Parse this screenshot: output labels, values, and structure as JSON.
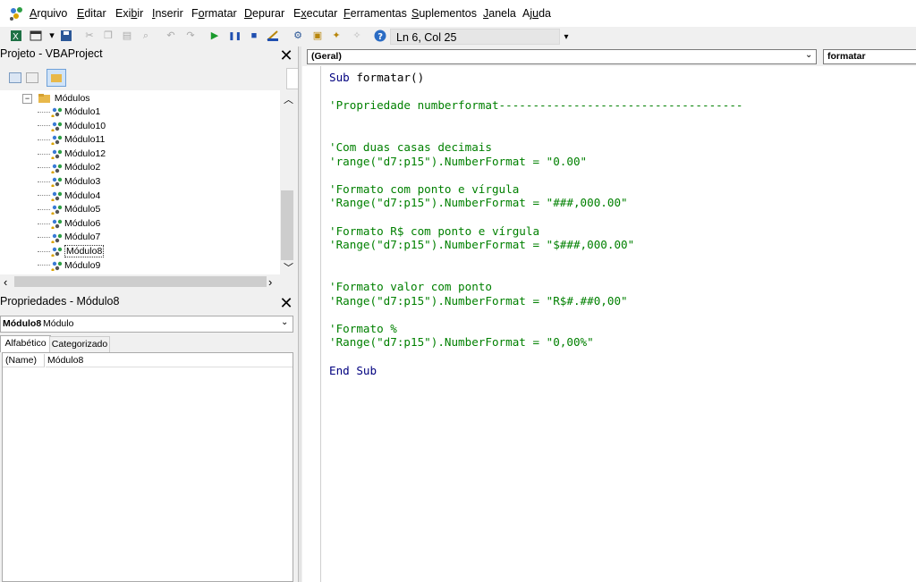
{
  "menu": [
    {
      "pre": "",
      "u": "A",
      "post": "rquivo"
    },
    {
      "pre": "",
      "u": "E",
      "post": "ditar"
    },
    {
      "pre": "Exi",
      "u": "b",
      "post": "ir"
    },
    {
      "pre": "",
      "u": "I",
      "post": "nserir"
    },
    {
      "pre": "F",
      "u": "o",
      "post": "rmatar"
    },
    {
      "pre": "",
      "u": "D",
      "post": "epurar"
    },
    {
      "pre": "E",
      "u": "x",
      "post": "ecutar"
    },
    {
      "pre": "",
      "u": "F",
      "post": "erramentas"
    },
    {
      "pre": "",
      "u": "S",
      "post": "uplementos"
    },
    {
      "pre": "",
      "u": "J",
      "post": "anela"
    },
    {
      "pre": "Aj",
      "u": "u",
      "post": "da"
    }
  ],
  "toolbar": {
    "cursor_position": "Ln 6, Col 25"
  },
  "project": {
    "title": "Projeto - VBAProject",
    "folder": "Módulos",
    "modules": [
      "Módulo1",
      "Módulo10",
      "Módulo11",
      "Módulo12",
      "Módulo2",
      "Módulo3",
      "Módulo4",
      "Módulo5",
      "Módulo6",
      "Módulo7",
      "Módulo8",
      "Módulo9"
    ],
    "selected_index": 10
  },
  "properties": {
    "title": "Propriedades - Módulo8",
    "object_name": "Módulo8",
    "object_type": "Módulo",
    "tabs": [
      "Alfabético",
      "Categorizado"
    ],
    "active_tab": 0,
    "rows": [
      {
        "name": "(Name)",
        "value": "Módulo8"
      }
    ]
  },
  "editor": {
    "object_dropdown": "(Geral)",
    "procedure_dropdown": "formatar",
    "lines": [
      {
        "kw": "Sub",
        "text": " formatar()",
        "type": "code"
      },
      {
        "text": "",
        "type": "blank"
      },
      {
        "text": "'Propriedade numberformat------------------------------------",
        "type": "comment"
      },
      {
        "text": "",
        "type": "blank"
      },
      {
        "text": "",
        "type": "blank"
      },
      {
        "text": "'Com duas casas decimais",
        "type": "comment"
      },
      {
        "text": "'range(\"d7:p15\").NumberFormat = \"0.00\"",
        "type": "comment"
      },
      {
        "text": "",
        "type": "blank"
      },
      {
        "text": "'Formato com ponto e vírgula",
        "type": "comment"
      },
      {
        "text": "'Range(\"d7:p15\").NumberFormat = \"###,000.00\"",
        "type": "comment"
      },
      {
        "text": "",
        "type": "blank"
      },
      {
        "text": "'Formato R$ com ponto e vírgula",
        "type": "comment"
      },
      {
        "text": "'Range(\"d7:p15\").NumberFormat = \"$###,000.00\"",
        "type": "comment"
      },
      {
        "text": "",
        "type": "blank"
      },
      {
        "text": "",
        "type": "blank"
      },
      {
        "text": "'Formato valor com ponto",
        "type": "comment"
      },
      {
        "text": "'Range(\"d7:p15\").NumberFormat = \"R$#.##0,00\"",
        "type": "comment"
      },
      {
        "text": "",
        "type": "blank"
      },
      {
        "text": "'Formato %",
        "type": "comment"
      },
      {
        "text": "'Range(\"d7:p15\").NumberFormat = \"0,00%\"",
        "type": "comment"
      },
      {
        "text": "",
        "type": "blank"
      },
      {
        "kw": "End Sub",
        "text": "",
        "type": "code"
      }
    ]
  }
}
